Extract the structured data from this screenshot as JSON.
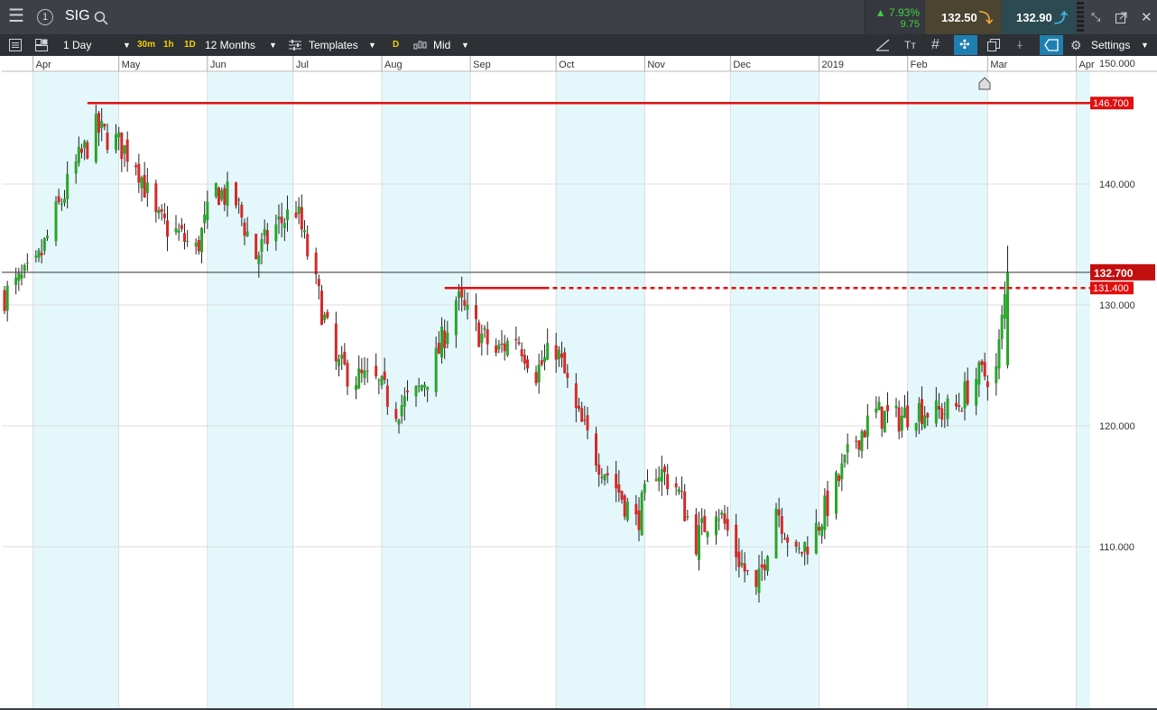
{
  "app": {
    "symbol": "SIG",
    "change_pct": "▲ 7.93%",
    "change_abs": "9.75",
    "sell_price": "132.50",
    "buy_price": "132.90"
  },
  "toolbar": {
    "interval": "1 Day",
    "quick_30m": "30m",
    "quick_1h": "1h",
    "quick_1d": "1D",
    "range": "12 Months",
    "templates": "Templates",
    "d_badge": "D",
    "price_mode": "Mid",
    "settings": "Settings",
    "text_tool": "Tт"
  },
  "colors": {
    "up": "#2aa52a",
    "down": "#d42a2a",
    "level": "#e10f0f",
    "shade": "#e4f8fb",
    "grid": "#dcdcdc",
    "accent": "#1f7fb0"
  },
  "chart_data": {
    "type": "candlestick",
    "ylim": [
      102,
      150
    ],
    "y_ticks": [
      {
        "value": 150,
        "label": "150.000"
      },
      {
        "value": 140,
        "label": "140.000"
      },
      {
        "value": 130,
        "label": "130.000"
      },
      {
        "value": 120,
        "label": "120.000"
      },
      {
        "value": 110,
        "label": "110.000"
      }
    ],
    "x_ticks": [
      {
        "date": "2018-04-01",
        "label": "Apr"
      },
      {
        "date": "2018-05-01",
        "label": "May"
      },
      {
        "date": "2018-06-01",
        "label": "Jun"
      },
      {
        "date": "2018-07-01",
        "label": "Jul"
      },
      {
        "date": "2018-08-01",
        "label": "Aug"
      },
      {
        "date": "2018-09-01",
        "label": "Sep"
      },
      {
        "date": "2018-10-01",
        "label": "Oct"
      },
      {
        "date": "2018-11-01",
        "label": "Nov"
      },
      {
        "date": "2018-12-01",
        "label": "Dec"
      },
      {
        "date": "2019-01-01",
        "label": "2019"
      },
      {
        "date": "2019-02-01",
        "label": "Feb"
      },
      {
        "date": "2019-03-01",
        "label": "Mar"
      },
      {
        "date": "2019-04-01",
        "label": "Apr"
      }
    ],
    "levels": [
      {
        "label": "146.700",
        "value": 146.7,
        "style": "solid",
        "start": "2018-04-20"
      },
      {
        "label": "131.400",
        "value": 131.4,
        "style": "dashed",
        "start": "2018-08-23",
        "solid_until": "2018-09-27"
      }
    ],
    "current_price": {
      "label": "132.700",
      "value": 132.7
    },
    "closes": [
      [
        "2018-03-22",
        130.8
      ],
      [
        "2018-04-02",
        133.0
      ],
      [
        "2018-04-09",
        137.5
      ],
      [
        "2018-04-16",
        141.5
      ],
      [
        "2018-04-23",
        144.5
      ],
      [
        "2018-04-30",
        143.5
      ],
      [
        "2018-05-07",
        142.0
      ],
      [
        "2018-05-14",
        137.0
      ],
      [
        "2018-05-21",
        136.0
      ],
      [
        "2018-05-28",
        134.5
      ],
      [
        "2018-06-04",
        139.5
      ],
      [
        "2018-06-11",
        138.5
      ],
      [
        "2018-06-18",
        134.0
      ],
      [
        "2018-06-25",
        136.5
      ],
      [
        "2018-07-02",
        138.0
      ],
      [
        "2018-07-09",
        131.5
      ],
      [
        "2018-07-16",
        125.0
      ],
      [
        "2018-07-23",
        124.0
      ],
      [
        "2018-07-30",
        123.5
      ],
      [
        "2018-08-06",
        121.5
      ],
      [
        "2018-08-13",
        122.5
      ],
      [
        "2018-08-20",
        125.5
      ],
      [
        "2018-08-27",
        130.5
      ],
      [
        "2018-09-03",
        128.0
      ],
      [
        "2018-09-10",
        126.0
      ],
      [
        "2018-09-17",
        127.5
      ],
      [
        "2018-09-24",
        124.5
      ],
      [
        "2018-10-01",
        126.5
      ],
      [
        "2018-10-08",
        121.0
      ],
      [
        "2018-10-15",
        117.5
      ],
      [
        "2018-10-22",
        115.0
      ],
      [
        "2018-10-29",
        112.0
      ],
      [
        "2018-11-05",
        116.5
      ],
      [
        "2018-11-12",
        115.0
      ],
      [
        "2018-11-19",
        110.5
      ],
      [
        "2018-11-26",
        113.5
      ],
      [
        "2018-12-03",
        109.5
      ],
      [
        "2018-12-10",
        106.0
      ],
      [
        "2018-12-17",
        113.5
      ],
      [
        "2018-12-24",
        109.0
      ],
      [
        "2018-12-31",
        111.5
      ],
      [
        "2019-01-07",
        115.0
      ],
      [
        "2019-01-14",
        119.0
      ],
      [
        "2019-01-21",
        121.0
      ],
      [
        "2019-01-28",
        120.5
      ],
      [
        "2019-02-04",
        121.5
      ],
      [
        "2019-02-11",
        121.0
      ],
      [
        "2019-02-18",
        121.5
      ],
      [
        "2019-02-25",
        124.0
      ],
      [
        "2019-03-04",
        124.5
      ],
      [
        "2019-03-08",
        132.7
      ]
    ]
  }
}
